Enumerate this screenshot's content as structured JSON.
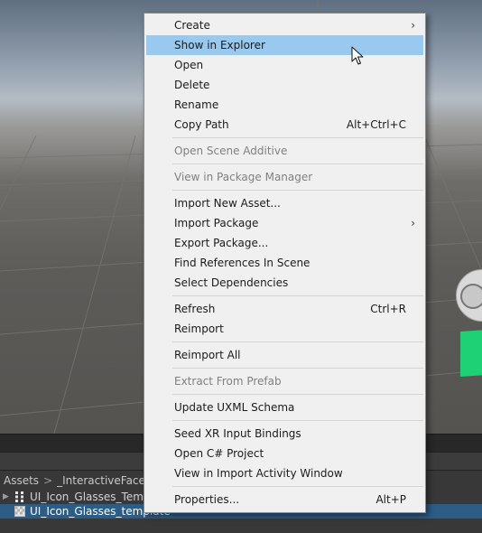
{
  "menu": {
    "items": [
      {
        "label": "Create",
        "submenu": true
      },
      {
        "label": "Show in Explorer",
        "highlighted": true
      },
      {
        "label": "Open"
      },
      {
        "label": "Delete"
      },
      {
        "label": "Rename"
      },
      {
        "label": "Copy Path",
        "shortcut": "Alt+Ctrl+C"
      },
      {
        "label": "Open Scene Additive",
        "disabled": true
      },
      {
        "label": "View in Package Manager",
        "disabled": true
      },
      {
        "label": "Import New Asset..."
      },
      {
        "label": "Import Package",
        "submenu": true
      },
      {
        "label": "Export Package..."
      },
      {
        "label": "Find References In Scene"
      },
      {
        "label": "Select Dependencies"
      },
      {
        "label": "Refresh",
        "shortcut": "Ctrl+R"
      },
      {
        "label": "Reimport"
      },
      {
        "label": "Reimport All"
      },
      {
        "label": "Extract From Prefab",
        "disabled": true
      },
      {
        "label": "Update UXML Schema"
      },
      {
        "label": "Seed XR Input Bindings"
      },
      {
        "label": "Open C# Project"
      },
      {
        "label": "View in Import Activity Window"
      },
      {
        "label": "Properties...",
        "shortcut": "Alt+P"
      }
    ]
  },
  "project": {
    "breadcrumb": [
      "Assets",
      "_InteractiveFaceF"
    ],
    "files": [
      {
        "name": "UI_Icon_Glasses_Temp",
        "selected": false
      },
      {
        "name": "UI_Icon_Glasses_template",
        "selected": true
      }
    ]
  },
  "icons": {
    "submenu": "chevron-right-icon",
    "breadcrumb_separator": "chevron-right-icon",
    "cursor": "mouse-pointer-icon"
  },
  "colors": {
    "menu_bg": "#f0f0f0",
    "highlight": "#99c9ef",
    "disabled_text": "#808080",
    "selection": "#2c5d87",
    "green_object": "#1fd175"
  }
}
